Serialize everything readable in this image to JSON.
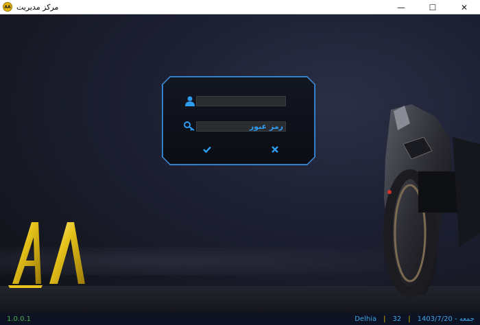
{
  "window": {
    "title": "مرکز مدیریت",
    "icon_label": "AA",
    "controls": {
      "minimize": "—",
      "maximize": "☐",
      "close": "✕"
    }
  },
  "login": {
    "username_value": "",
    "password_placeholder": "رمز عبور",
    "ok_icon": "check-icon",
    "cancel_icon": "x-icon",
    "accent_color": "#2e9cf0"
  },
  "logo": {
    "text": "AA",
    "color": "#e6c21a"
  },
  "status": {
    "version": "1.0.0.1",
    "user": "Delhia",
    "number": "32",
    "date": "1403/7/20 - جمعه"
  }
}
